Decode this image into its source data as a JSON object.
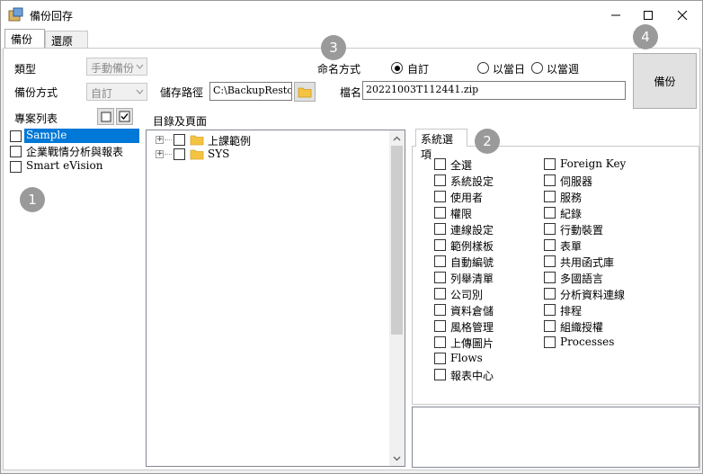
{
  "window": {
    "title": "備份回存"
  },
  "tabs": [
    {
      "label": "備份"
    },
    {
      "label": "還原"
    }
  ],
  "form": {
    "type_label": "類型",
    "type_value": "手動備份",
    "mode_label": "備份方式",
    "mode_value": "自訂",
    "path_label": "儲存路徑",
    "path_value": "C:\\BackupRestor",
    "naming_label": "命名方式",
    "naming_opt_custom": "自訂",
    "naming_opt_day": "以當日",
    "naming_opt_week": "以當週",
    "filename_label": "檔名",
    "filename_value": "20221003T112441.zip",
    "backup_button": "備份"
  },
  "projects": {
    "label": "專案列表",
    "items": [
      "Sample",
      "企業戰情分析與報表",
      "Smart eVision"
    ]
  },
  "tree": {
    "label": "目錄及頁面",
    "nodes": [
      "上課範例",
      "SYS"
    ]
  },
  "options": {
    "tab_label": "系統選項",
    "col1": [
      "全選",
      "系統設定",
      "使用者",
      "權限",
      "連線設定",
      "範例樣板",
      "自動編號",
      "列舉清單",
      "公司別",
      "資料倉儲",
      "風格管理",
      "上傳圖片",
      "Flows",
      "報表中心"
    ],
    "col2": [
      "Foreign Key",
      "伺服器",
      "服務",
      "紀錄",
      "行動裝置",
      "表單",
      "共用函式庫",
      "多國語言",
      "分析資料連線",
      "排程",
      "組織授權",
      "Processes"
    ]
  },
  "badges": [
    "1",
    "2",
    "3",
    "4"
  ],
  "colors": {
    "selection": "#0078d7",
    "badge": "#9a9a9a",
    "folder": "#f5c342"
  }
}
